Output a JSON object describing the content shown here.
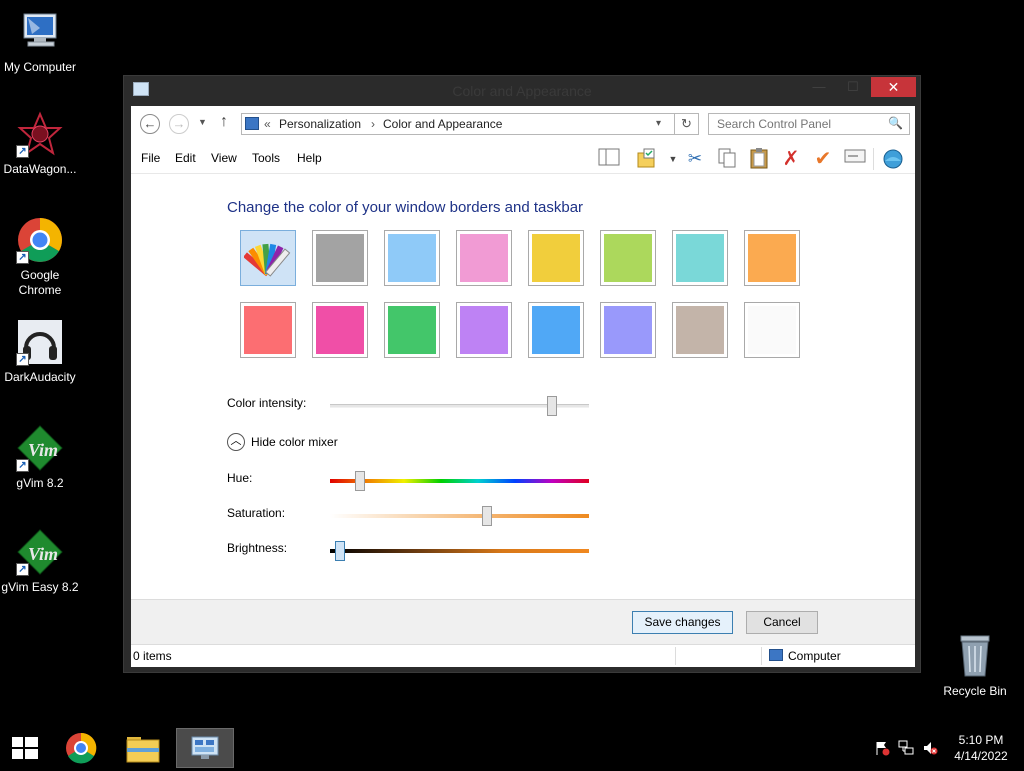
{
  "desktop": {
    "icons": [
      {
        "label": "My Computer",
        "icon": "computer-icon"
      },
      {
        "label": "DataWagon...",
        "icon": "datawagon-icon"
      },
      {
        "label": "Google Chrome",
        "icon": "chrome-icon"
      },
      {
        "label": "DarkAudacity",
        "icon": "headphones-icon"
      },
      {
        "label": "gVim 8.2",
        "icon": "vim-icon"
      },
      {
        "label": "gVim Easy 8.2",
        "icon": "vim-icon"
      },
      {
        "label": "Recycle Bin",
        "icon": "recycle-bin-icon"
      }
    ]
  },
  "window": {
    "title": "Color and Appearance",
    "close_glyph": "✕",
    "minimize_glyph": "—",
    "maximize_glyph": "☐"
  },
  "address": {
    "separator": "«",
    "crumbs": [
      "Personalization",
      "Color and Appearance"
    ],
    "arrow": "›",
    "search_placeholder": "Search Control Panel"
  },
  "menu": {
    "items": [
      "File",
      "Edit",
      "View",
      "Tools",
      "Help"
    ]
  },
  "content": {
    "heading": "Change the color of your window borders and taskbar",
    "swatches_row1": [
      "custom",
      "#a3a3a3",
      "#8fcaf8",
      "#f19bd4",
      "#f1ce3c",
      "#acd85c",
      "#7ad8d8",
      "#fbaa50"
    ],
    "swatches_row2": [
      "#fc6e72",
      "#f04fa7",
      "#43c66a",
      "#be82f4",
      "#50a8f6",
      "#9999fb",
      "#c3b4a9",
      "#fafafa"
    ],
    "intensity_label": "Color intensity:",
    "intensity_value": 0.87,
    "mixer_label": "Hide color mixer",
    "hue_label": "Hue:",
    "hue_value": 0.1,
    "saturation_label": "Saturation:",
    "saturation_value": 0.61,
    "brightness_label": "Brightness:",
    "brightness_value": 0.02
  },
  "footer": {
    "save_label": "Save changes",
    "cancel_label": "Cancel"
  },
  "status": {
    "items_text": "0 items",
    "location_text": "Computer"
  },
  "taskbar": {
    "time": "5:10 PM",
    "date": "4/14/2022"
  }
}
